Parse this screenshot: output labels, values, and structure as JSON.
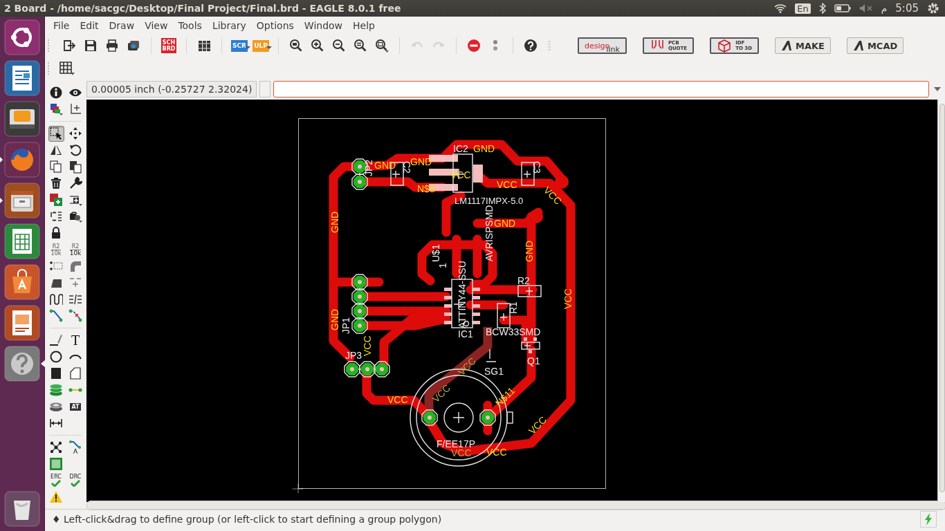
{
  "panel": {
    "title": "2 Board - /home/sacgc/Desktop/Final Project/Final.brd - EAGLE 8.0.1 free",
    "keyboard": "En",
    "ampm": "م",
    "clock": "5:05"
  },
  "launcher": [
    {
      "kind": "ubuntu",
      "running": false,
      "focused": false
    },
    {
      "kind": "writer",
      "running": false,
      "focused": false
    },
    {
      "kind": "sublime",
      "running": false,
      "focused": false
    },
    {
      "kind": "firefox",
      "running": true,
      "focused": false
    },
    {
      "kind": "files",
      "running": true,
      "focused": false
    },
    {
      "kind": "calc",
      "running": false,
      "focused": false
    },
    {
      "kind": "software",
      "running": false,
      "focused": false
    },
    {
      "kind": "impress",
      "running": false,
      "focused": false
    },
    {
      "kind": "help",
      "running": false,
      "focused": true
    },
    {
      "kind": "trash",
      "running": false,
      "focused": false
    }
  ],
  "menu": [
    "File",
    "Edit",
    "Draw",
    "View",
    "Tools",
    "Library",
    "Options",
    "Window",
    "Help"
  ],
  "toolbar": [
    {
      "kind": "export",
      "disabled": false
    },
    {
      "kind": "save",
      "disabled": false
    },
    {
      "kind": "print",
      "disabled": false
    },
    {
      "kind": "camera",
      "disabled": false
    },
    {
      "kind": "sep"
    },
    {
      "kind": "schbrd",
      "disabled": false,
      "label": "SCH",
      "label2": "BRD"
    },
    {
      "kind": "sep"
    },
    {
      "kind": "books",
      "disabled": false
    },
    {
      "kind": "sep"
    },
    {
      "kind": "scr",
      "disabled": false,
      "label": "SCR"
    },
    {
      "kind": "ulp",
      "disabled": false,
      "label": "ULP"
    },
    {
      "kind": "sep"
    },
    {
      "kind": "zoomfit",
      "disabled": false
    },
    {
      "kind": "zoomin",
      "disabled": false
    },
    {
      "kind": "zoomout",
      "disabled": false
    },
    {
      "kind": "zoomredraw",
      "disabled": false
    },
    {
      "kind": "zoomselect",
      "disabled": false
    },
    {
      "kind": "sep"
    },
    {
      "kind": "undo",
      "disabled": true
    },
    {
      "kind": "redo",
      "disabled": true
    },
    {
      "kind": "sep"
    },
    {
      "kind": "stop",
      "disabled": false
    },
    {
      "kind": "go",
      "disabled": false
    },
    {
      "kind": "sep"
    },
    {
      "kind": "help",
      "disabled": false
    },
    {
      "kind": "grip",
      "disabled": false
    },
    {
      "kind": "designlink",
      "disabled": false,
      "label": "design",
      "label2": "link"
    },
    {
      "kind": "pcbquote",
      "disabled": false,
      "label": "PCB",
      "label2": "QUOTE"
    },
    {
      "kind": "idf",
      "disabled": false,
      "label": "IDF",
      "label2": "TO 3D"
    },
    {
      "kind": "make",
      "disabled": false,
      "label": "MAKE"
    },
    {
      "kind": "mcad",
      "disabled": false,
      "label": "MCAD"
    }
  ],
  "coordinates": "0.00005 inch (-0.25727 2.32024)",
  "tool_groups": [
    [
      {
        "kind": "info",
        "selected": false
      },
      {
        "kind": "eye",
        "selected": false
      },
      {
        "kind": "layers",
        "selected": false
      },
      {
        "kind": "mark",
        "selected": false
      }
    ],
    [
      {
        "kind": "group",
        "selected": true
      },
      {
        "kind": "move",
        "selected": false
      },
      {
        "kind": "mirror",
        "selected": false
      },
      {
        "kind": "rotate",
        "selected": false
      },
      {
        "kind": "copy",
        "selected": false
      },
      {
        "kind": "paste",
        "selected": false
      },
      {
        "kind": "delete",
        "selected": false
      },
      {
        "kind": "wrench",
        "selected": false
      },
      {
        "kind": "add",
        "selected": false
      },
      {
        "kind": "replace",
        "selected": false
      },
      {
        "kind": "swap",
        "selected": false
      },
      {
        "kind": "smash",
        "selected": false
      },
      {
        "kind": "lock",
        "selected": false
      },
      {
        "kind": "name",
        "selected": false,
        "label": "R2",
        "label2": "10k"
      },
      {
        "kind": "value",
        "selected": false,
        "label": "R2",
        "label2": "10k"
      },
      {
        "kind": "split",
        "selected": false
      },
      {
        "kind": "miter",
        "selected": false
      },
      {
        "kind": "slice",
        "selected": false
      },
      {
        "kind": "optimize",
        "selected": false
      },
      {
        "kind": "meander",
        "selected": false
      },
      {
        "kind": "ripupbars",
        "selected": false
      },
      {
        "kind": "route",
        "selected": false
      },
      {
        "kind": "ripup",
        "selected": false
      }
    ],
    [
      {
        "kind": "wire",
        "selected": false
      },
      {
        "kind": "text",
        "selected": false,
        "label": "T"
      },
      {
        "kind": "circle",
        "selected": false
      },
      {
        "kind": "arc",
        "selected": false
      },
      {
        "kind": "rect",
        "selected": false
      },
      {
        "kind": "polygon",
        "selected": false
      },
      {
        "kind": "via",
        "selected": false
      },
      {
        "kind": "signal",
        "selected": false
      },
      {
        "kind": "hole",
        "selected": false
      },
      {
        "kind": "attribute",
        "selected": false,
        "label": "AT"
      },
      {
        "kind": "dimension",
        "selected": false
      }
    ],
    [
      {
        "kind": "ratsnest",
        "selected": false
      },
      {
        "kind": "autoroute",
        "selected": false,
        "label": "A"
      },
      {
        "kind": "fill",
        "selected": false
      },
      {
        "kind": "erc",
        "label": "ERC"
      },
      {
        "kind": "drc",
        "label": "DRC"
      },
      {
        "kind": "warning",
        "selected": false
      }
    ]
  ],
  "board": {
    "labels": [
      {
        "text": "IC2",
        "kind": "part"
      },
      {
        "text": "GND",
        "kind": "net"
      },
      {
        "text": "GND",
        "kind": "net"
      },
      {
        "text": "JP2",
        "kind": "part"
      },
      {
        "text": "GND",
        "kind": "net"
      },
      {
        "text": "C2",
        "kind": "part"
      },
      {
        "text": "VCC",
        "kind": "net"
      },
      {
        "text": "N$3",
        "kind": "net"
      },
      {
        "text": "VCC",
        "kind": "net"
      },
      {
        "text": "C3",
        "kind": "part"
      },
      {
        "text": "VCC",
        "kind": "net"
      },
      {
        "text": "LM1117IMPX-5.0",
        "kind": "part"
      },
      {
        "text": "AVRISPSMD",
        "kind": "part"
      },
      {
        "text": "GND",
        "kind": "net"
      },
      {
        "text": "GND",
        "kind": "net"
      },
      {
        "text": "U$1",
        "kind": "part"
      },
      {
        "text": "1",
        "kind": "part"
      },
      {
        "text": "ATTINY44-SSU",
        "kind": "part"
      },
      {
        "text": "GND",
        "kind": "net"
      },
      {
        "text": "R2",
        "kind": "part"
      },
      {
        "text": "VCC",
        "kind": "net"
      },
      {
        "text": "R1",
        "kind": "part"
      },
      {
        "text": "GND",
        "kind": "net"
      },
      {
        "text": "JP1",
        "kind": "part"
      },
      {
        "text": "IC1",
        "kind": "part"
      },
      {
        "text": "BCW33SMD",
        "kind": "part"
      },
      {
        "text": "Q1",
        "kind": "part"
      },
      {
        "text": "JP3",
        "kind": "part"
      },
      {
        "text": "VCC",
        "kind": "net"
      },
      {
        "text": "SG1",
        "kind": "part"
      },
      {
        "text": "VCC",
        "kind": "bottom-net"
      },
      {
        "text": "VCC",
        "kind": "bottom-net"
      },
      {
        "text": "VCC",
        "kind": "net"
      },
      {
        "text": "N$11",
        "kind": "net"
      },
      {
        "text": "VCC",
        "kind": "net"
      },
      {
        "text": "F/EE17P",
        "kind": "part"
      },
      {
        "text": "VCC",
        "kind": "bottom-net"
      },
      {
        "text": "VCC",
        "kind": "net"
      }
    ]
  },
  "status": "♦ Left-click&drag to define group (or left-click to start defining a group polygon)"
}
